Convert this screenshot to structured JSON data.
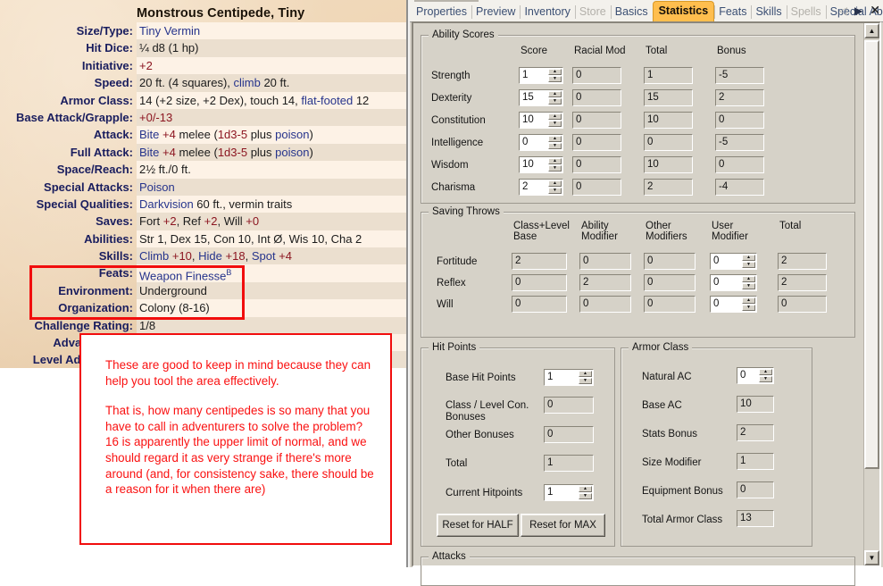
{
  "statblock": {
    "title": "Monstrous Centipede, Tiny",
    "rows": [
      {
        "label": "Size/Type:",
        "value": "Tiny Vermin",
        "style": "blue"
      },
      {
        "label": "Hit Dice:",
        "value": "¼ d8 (1 hp)",
        "style": "plain"
      },
      {
        "label": "Initiative:",
        "value": "+2",
        "style": "red"
      },
      {
        "label": "Speed:",
        "value": "20 ft. (4 squares), climb 20 ft.",
        "style": "speed"
      },
      {
        "label": "Armor Class:",
        "value": "14 (+2 size, +2 Dex), touch 14, flat-footed 12",
        "style": "ac"
      },
      {
        "label": "Base Attack/Grapple:",
        "value": "+0/-13",
        "style": "red"
      },
      {
        "label": "Attack:",
        "value": "Bite +4 melee (1d3-5 plus poison)",
        "style": "attack"
      },
      {
        "label": "Full Attack:",
        "value": "Bite +4 melee (1d3-5 plus poison)",
        "style": "attack"
      },
      {
        "label": "Space/Reach:",
        "value": "2½ ft./0 ft.",
        "style": "plain"
      },
      {
        "label": "Special Attacks:",
        "value": "Poison",
        "style": "blue"
      },
      {
        "label": "Special Qualities:",
        "value": "Darkvision 60 ft., vermin traits",
        "style": "sq"
      },
      {
        "label": "Saves:",
        "value": "Fort +2, Ref +2, Will +0",
        "style": "saves"
      },
      {
        "label": "Abilities:",
        "value": "Str 1, Dex 15, Con 10, Int Ø, Wis 10, Cha 2",
        "style": "plain"
      },
      {
        "label": "Skills:",
        "value": "Climb +10, Hide +18, Spot +4",
        "style": "skills"
      },
      {
        "label": "Feats:",
        "value": "Weapon Finesse",
        "value_sup": "B",
        "style": "feats"
      },
      {
        "label": "Environment:",
        "value": "Underground",
        "style": "plain"
      },
      {
        "label": "Organization:",
        "value": "Colony (8-16)",
        "style": "plain"
      },
      {
        "label": "Challenge Rating:",
        "value": "1/8",
        "style": "plain"
      },
      {
        "label": "Advancement:",
        "value": "",
        "style": "plain"
      },
      {
        "label": "Level Adjustment:",
        "value": "",
        "style": "plain"
      }
    ]
  },
  "annotation": {
    "highlight_target": "Environment / Organization rows",
    "paragraph_1": "These are good to keep in mind because they can help you tool the area effectively.",
    "paragraph_2": "That is, how many centipedes is so many that you have to call in adventurers to solve the problem? 16 is apparently the upper limit of normal, and we should regard it as very strange if there's more around (and, for consistency sake, there should be a reason for it when there are)",
    "color": "#fa1111"
  },
  "form": {
    "tabs": [
      {
        "label": "Properties",
        "state": "normal"
      },
      {
        "label": "Preview",
        "state": "normal"
      },
      {
        "label": "Inventory",
        "state": "normal"
      },
      {
        "label": "Store",
        "state": "disabled"
      },
      {
        "label": "Basics",
        "state": "normal"
      },
      {
        "label": "Statistics",
        "state": "active"
      },
      {
        "label": "Feats",
        "state": "normal"
      },
      {
        "label": "Skills",
        "state": "normal"
      },
      {
        "label": "Spells",
        "state": "disabled"
      },
      {
        "label": "Special Abili",
        "state": "normal"
      }
    ],
    "tab_nav": {
      "prev": "◁",
      "next": "▶",
      "close": "✕"
    },
    "active_tab_color": "#ffbe4e",
    "ability_scores": {
      "title": "Ability Scores",
      "columns": [
        "Score",
        "Racial Mod",
        "Total",
        "Bonus"
      ],
      "rows": [
        {
          "name": "Strength",
          "score": "1",
          "racial": "0",
          "total": "1",
          "bonus": "-5"
        },
        {
          "name": "Dexterity",
          "score": "15",
          "racial": "0",
          "total": "15",
          "bonus": "2"
        },
        {
          "name": "Constitution",
          "score": "10",
          "racial": "0",
          "total": "10",
          "bonus": "0"
        },
        {
          "name": "Intelligence",
          "score": "0",
          "racial": "0",
          "total": "0",
          "bonus": "-5"
        },
        {
          "name": "Wisdom",
          "score": "10",
          "racial": "0",
          "total": "10",
          "bonus": "0"
        },
        {
          "name": "Charisma",
          "score": "2",
          "racial": "0",
          "total": "2",
          "bonus": "-4"
        }
      ]
    },
    "saving_throws": {
      "title": "Saving Throws",
      "columns": [
        "Class+Level Base",
        "Ability Modifier",
        "Other Modifiers",
        "User Modifier",
        "Total"
      ],
      "rows": [
        {
          "name": "Fortitude",
          "base": "2",
          "ability": "0",
          "other": "0",
          "user": "0",
          "total": "2"
        },
        {
          "name": "Reflex",
          "base": "0",
          "ability": "2",
          "other": "0",
          "user": "0",
          "total": "2"
        },
        {
          "name": "Will",
          "base": "0",
          "ability": "0",
          "other": "0",
          "user": "0",
          "total": "0"
        }
      ]
    },
    "hit_points": {
      "title": "Hit Points",
      "rows": [
        {
          "label": "Base Hit Points",
          "value": "1",
          "spinner": true
        },
        {
          "label": "Class / Level Con. Bonuses",
          "value": "0",
          "spinner": false
        },
        {
          "label": "Other Bonuses",
          "value": "0",
          "spinner": false
        },
        {
          "label": "Total",
          "value": "1",
          "spinner": false
        },
        {
          "label": "Current Hitpoints",
          "value": "1",
          "spinner": true
        }
      ],
      "reset_half": "Reset for HALF",
      "reset_max": "Reset for MAX"
    },
    "armor_class": {
      "title": "Armor Class",
      "rows": [
        {
          "label": "Natural AC",
          "value": "0",
          "spinner": true
        },
        {
          "label": "Base AC",
          "value": "10",
          "spinner": false
        },
        {
          "label": "Stats Bonus",
          "value": "2",
          "spinner": false
        },
        {
          "label": "Size Modifier",
          "value": "1",
          "spinner": false
        },
        {
          "label": "Equipment Bonus",
          "value": "0",
          "spinner": false
        },
        {
          "label": "Total Armor Class",
          "value": "13",
          "spinner": false
        }
      ]
    },
    "attacks": {
      "title": "Attacks"
    },
    "scrollbar": {
      "up": "▲",
      "down": "▼"
    }
  }
}
